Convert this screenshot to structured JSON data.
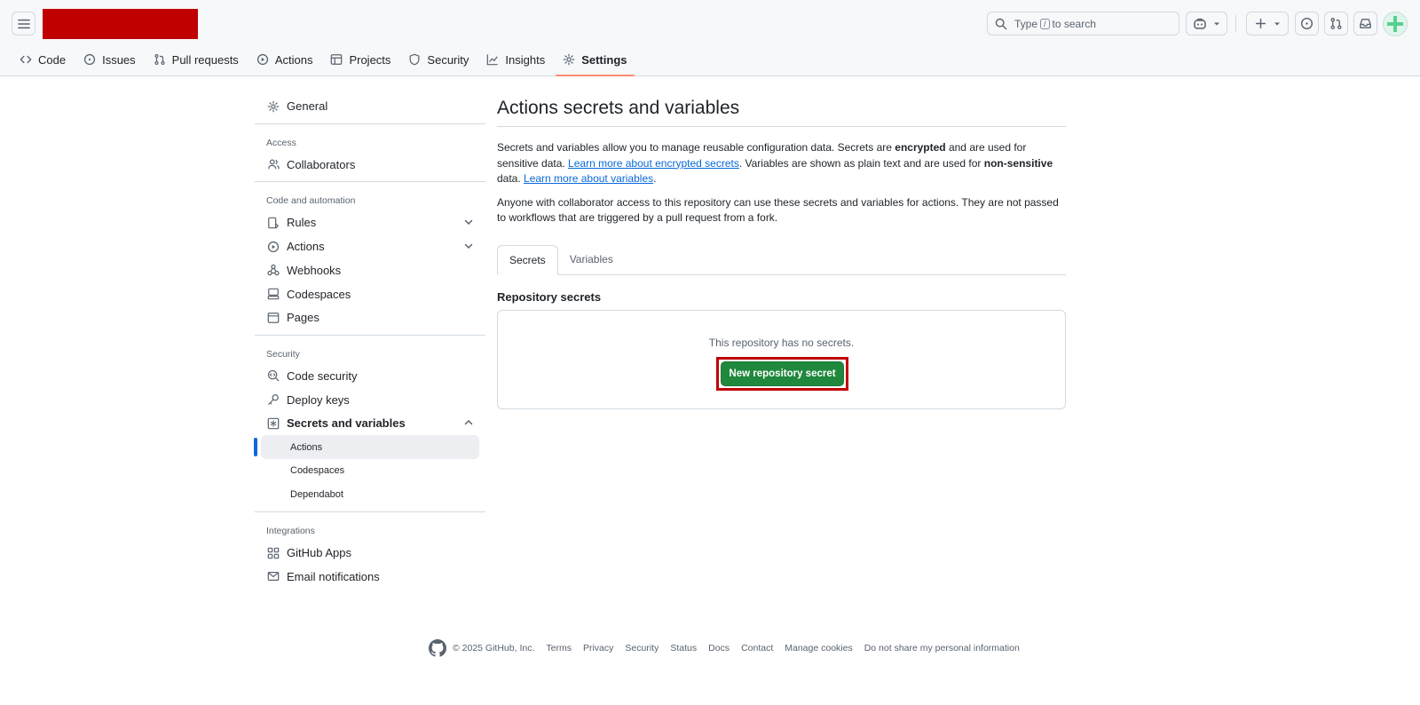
{
  "header": {
    "search_text_pre": "Type",
    "search_kbd": "/",
    "search_text_post": "to search"
  },
  "repo_tabs": [
    {
      "label": "Code",
      "icon": "code-icon"
    },
    {
      "label": "Issues",
      "icon": "issue-opened-icon"
    },
    {
      "label": "Pull requests",
      "icon": "git-pull-request-icon"
    },
    {
      "label": "Actions",
      "icon": "play-icon"
    },
    {
      "label": "Projects",
      "icon": "table-icon"
    },
    {
      "label": "Security",
      "icon": "shield-icon"
    },
    {
      "label": "Insights",
      "icon": "graph-icon"
    },
    {
      "label": "Settings",
      "icon": "gear-icon",
      "active": true
    }
  ],
  "sidebar": {
    "general": "General",
    "access_heading": "Access",
    "collaborators": "Collaborators",
    "code_automation_heading": "Code and automation",
    "rules": "Rules",
    "actions": "Actions",
    "webhooks": "Webhooks",
    "codespaces": "Codespaces",
    "pages": "Pages",
    "security_heading": "Security",
    "code_security": "Code security",
    "deploy_keys": "Deploy keys",
    "secrets_variables": "Secrets and variables",
    "sub_actions": "Actions",
    "sub_codespaces": "Codespaces",
    "sub_dependabot": "Dependabot",
    "integrations_heading": "Integrations",
    "github_apps": "GitHub Apps",
    "email_notifications": "Email notifications"
  },
  "main": {
    "title": "Actions secrets and variables",
    "desc_1": "Secrets and variables allow you to manage reusable configuration data. Secrets are ",
    "desc_encrypted": "encrypted",
    "desc_2": " and are used for sensitive data. ",
    "link_secrets": "Learn more about encrypted secrets",
    "desc_3": ". Variables are shown as plain text and are used for ",
    "desc_nonsensitive": "non-sensitive",
    "desc_4": " data. ",
    "link_variables": "Learn more about variables",
    "desc_5": ".",
    "desc_second": "Anyone with collaborator access to this repository can use these secrets and variables for actions. They are not passed to workflows that are triggered by a pull request from a fork.",
    "tab_secrets": "Secrets",
    "tab_variables": "Variables",
    "section_title": "Repository secrets",
    "empty_message": "This repository has no secrets.",
    "new_secret_button": "New repository secret"
  },
  "footer": {
    "copyright": "© 2025 GitHub, Inc.",
    "links": [
      "Terms",
      "Privacy",
      "Security",
      "Status",
      "Docs",
      "Contact",
      "Manage cookies",
      "Do not share my personal information"
    ]
  },
  "colors": {
    "primary_button": "#1f883d",
    "link": "#0969da",
    "active_tab_underline": "#fd8c73",
    "highlight_box": "#c00000"
  }
}
